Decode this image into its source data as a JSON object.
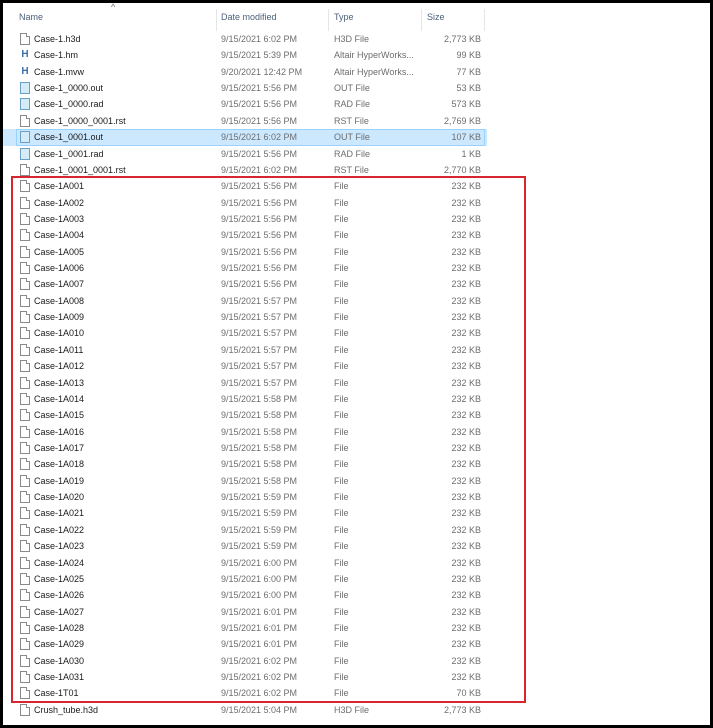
{
  "columns": {
    "name": "Name",
    "date": "Date modified",
    "type": "Type",
    "size": "Size"
  },
  "files": [
    {
      "name": "Case-1.h3d",
      "date": "9/15/2021 6:02 PM",
      "type": "H3D File",
      "size": "2,773 KB",
      "icon": "file-icon"
    },
    {
      "name": "Case-1.hm",
      "date": "9/15/2021 5:39 PM",
      "type": "Altair HyperWorks...",
      "size": "99 KB",
      "icon": "hyperworks-icon"
    },
    {
      "name": "Case-1.mvw",
      "date": "9/20/2021 12:42 PM",
      "type": "Altair HyperWorks...",
      "size": "77 KB",
      "icon": "hyperworks-icon"
    },
    {
      "name": "Case-1_0000.out",
      "date": "9/15/2021 5:56 PM",
      "type": "OUT File",
      "size": "53 KB",
      "icon": "out-file-icon"
    },
    {
      "name": "Case-1_0000.rad",
      "date": "9/15/2021 5:56 PM",
      "type": "RAD File",
      "size": "573 KB",
      "icon": "out-file-icon"
    },
    {
      "name": "Case-1_0000_0001.rst",
      "date": "9/15/2021 5:56 PM",
      "type": "RST File",
      "size": "2,769 KB",
      "icon": "file-icon"
    },
    {
      "name": "Case-1_0001.out",
      "date": "9/15/2021 6:02 PM",
      "type": "OUT File",
      "size": "107 KB",
      "icon": "out-file-icon",
      "selected": true
    },
    {
      "name": "Case-1_0001.rad",
      "date": "9/15/2021 5:56 PM",
      "type": "RAD File",
      "size": "1 KB",
      "icon": "out-file-icon"
    },
    {
      "name": "Case-1_0001_0001.rst",
      "date": "9/15/2021 6:02 PM",
      "type": "RST File",
      "size": "2,770 KB",
      "icon": "file-icon"
    },
    {
      "name": "Case-1A001",
      "date": "9/15/2021 5:56 PM",
      "type": "File",
      "size": "232 KB",
      "icon": "file-icon"
    },
    {
      "name": "Case-1A002",
      "date": "9/15/2021 5:56 PM",
      "type": "File",
      "size": "232 KB",
      "icon": "file-icon"
    },
    {
      "name": "Case-1A003",
      "date": "9/15/2021 5:56 PM",
      "type": "File",
      "size": "232 KB",
      "icon": "file-icon"
    },
    {
      "name": "Case-1A004",
      "date": "9/15/2021 5:56 PM",
      "type": "File",
      "size": "232 KB",
      "icon": "file-icon"
    },
    {
      "name": "Case-1A005",
      "date": "9/15/2021 5:56 PM",
      "type": "File",
      "size": "232 KB",
      "icon": "file-icon"
    },
    {
      "name": "Case-1A006",
      "date": "9/15/2021 5:56 PM",
      "type": "File",
      "size": "232 KB",
      "icon": "file-icon"
    },
    {
      "name": "Case-1A007",
      "date": "9/15/2021 5:56 PM",
      "type": "File",
      "size": "232 KB",
      "icon": "file-icon"
    },
    {
      "name": "Case-1A008",
      "date": "9/15/2021 5:57 PM",
      "type": "File",
      "size": "232 KB",
      "icon": "file-icon"
    },
    {
      "name": "Case-1A009",
      "date": "9/15/2021 5:57 PM",
      "type": "File",
      "size": "232 KB",
      "icon": "file-icon"
    },
    {
      "name": "Case-1A010",
      "date": "9/15/2021 5:57 PM",
      "type": "File",
      "size": "232 KB",
      "icon": "file-icon"
    },
    {
      "name": "Case-1A011",
      "date": "9/15/2021 5:57 PM",
      "type": "File",
      "size": "232 KB",
      "icon": "file-icon"
    },
    {
      "name": "Case-1A012",
      "date": "9/15/2021 5:57 PM",
      "type": "File",
      "size": "232 KB",
      "icon": "file-icon"
    },
    {
      "name": "Case-1A013",
      "date": "9/15/2021 5:57 PM",
      "type": "File",
      "size": "232 KB",
      "icon": "file-icon"
    },
    {
      "name": "Case-1A014",
      "date": "9/15/2021 5:58 PM",
      "type": "File",
      "size": "232 KB",
      "icon": "file-icon"
    },
    {
      "name": "Case-1A015",
      "date": "9/15/2021 5:58 PM",
      "type": "File",
      "size": "232 KB",
      "icon": "file-icon"
    },
    {
      "name": "Case-1A016",
      "date": "9/15/2021 5:58 PM",
      "type": "File",
      "size": "232 KB",
      "icon": "file-icon"
    },
    {
      "name": "Case-1A017",
      "date": "9/15/2021 5:58 PM",
      "type": "File",
      "size": "232 KB",
      "icon": "file-icon"
    },
    {
      "name": "Case-1A018",
      "date": "9/15/2021 5:58 PM",
      "type": "File",
      "size": "232 KB",
      "icon": "file-icon"
    },
    {
      "name": "Case-1A019",
      "date": "9/15/2021 5:58 PM",
      "type": "File",
      "size": "232 KB",
      "icon": "file-icon"
    },
    {
      "name": "Case-1A020",
      "date": "9/15/2021 5:59 PM",
      "type": "File",
      "size": "232 KB",
      "icon": "file-icon"
    },
    {
      "name": "Case-1A021",
      "date": "9/15/2021 5:59 PM",
      "type": "File",
      "size": "232 KB",
      "icon": "file-icon"
    },
    {
      "name": "Case-1A022",
      "date": "9/15/2021 5:59 PM",
      "type": "File",
      "size": "232 KB",
      "icon": "file-icon"
    },
    {
      "name": "Case-1A023",
      "date": "9/15/2021 5:59 PM",
      "type": "File",
      "size": "232 KB",
      "icon": "file-icon"
    },
    {
      "name": "Case-1A024",
      "date": "9/15/2021 6:00 PM",
      "type": "File",
      "size": "232 KB",
      "icon": "file-icon"
    },
    {
      "name": "Case-1A025",
      "date": "9/15/2021 6:00 PM",
      "type": "File",
      "size": "232 KB",
      "icon": "file-icon"
    },
    {
      "name": "Case-1A026",
      "date": "9/15/2021 6:00 PM",
      "type": "File",
      "size": "232 KB",
      "icon": "file-icon"
    },
    {
      "name": "Case-1A027",
      "date": "9/15/2021 6:01 PM",
      "type": "File",
      "size": "232 KB",
      "icon": "file-icon"
    },
    {
      "name": "Case-1A028",
      "date": "9/15/2021 6:01 PM",
      "type": "File",
      "size": "232 KB",
      "icon": "file-icon"
    },
    {
      "name": "Case-1A029",
      "date": "9/15/2021 6:01 PM",
      "type": "File",
      "size": "232 KB",
      "icon": "file-icon"
    },
    {
      "name": "Case-1A030",
      "date": "9/15/2021 6:02 PM",
      "type": "File",
      "size": "232 KB",
      "icon": "file-icon"
    },
    {
      "name": "Case-1A031",
      "date": "9/15/2021 6:02 PM",
      "type": "File",
      "size": "232 KB",
      "icon": "file-icon"
    },
    {
      "name": "Case-1T01",
      "date": "9/15/2021 6:02 PM",
      "type": "File",
      "size": "70 KB",
      "icon": "file-icon"
    },
    {
      "name": "Crush_tube.h3d",
      "date": "9/15/2021 5:04 PM",
      "type": "H3D File",
      "size": "2,773 KB",
      "icon": "file-icon"
    }
  ],
  "colors": {
    "highlight": "#d7262d",
    "selection": "#cce8ff"
  }
}
